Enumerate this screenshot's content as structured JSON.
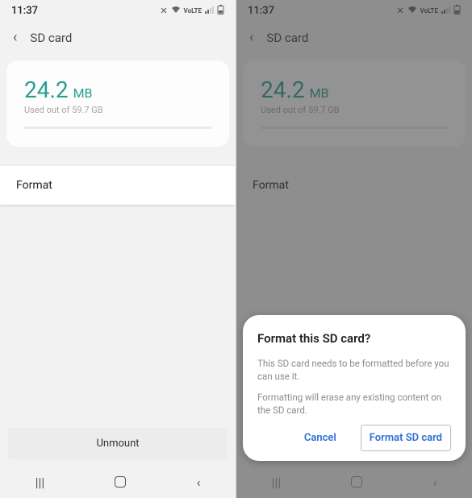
{
  "status": {
    "time": "11:37",
    "icons": [
      "mute-icon",
      "wifi-icon",
      "volte-icon",
      "signal-icon",
      "battery-icon"
    ]
  },
  "header": {
    "title": "SD card"
  },
  "storage": {
    "amount": "24.2",
    "unit": "MB",
    "subtext": "Used out of 59.7 GB"
  },
  "list": {
    "format_label": "Format"
  },
  "footer": {
    "unmount_label": "Unmount"
  },
  "dialog": {
    "title": "Format this SD card?",
    "line1": "This SD card needs to be formatted before you can use it.",
    "line2": "Formatting will erase any existing content on the SD card.",
    "cancel": "Cancel",
    "confirm": "Format SD card"
  }
}
